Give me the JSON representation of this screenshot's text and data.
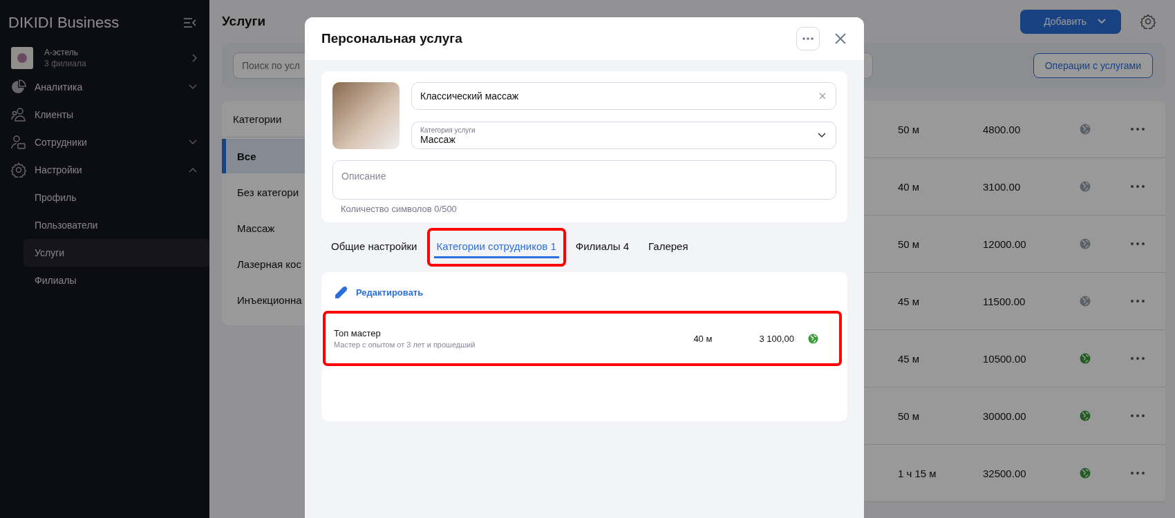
{
  "sidebar": {
    "brand": "DIKIDI Business",
    "account": {
      "name": "А-эстель",
      "subtitle": "3 филиала"
    },
    "nav": [
      {
        "label": "Аналитика",
        "kind": "group",
        "expanded": false
      },
      {
        "label": "Клиенты",
        "kind": "link"
      },
      {
        "label": "Сотрудники",
        "kind": "group",
        "expanded": false
      },
      {
        "label": "Настройки",
        "kind": "group",
        "expanded": true,
        "children": [
          {
            "label": "Профиль",
            "selected": false
          },
          {
            "label": "Пользователи",
            "selected": false
          },
          {
            "label": "Услуги",
            "selected": true
          },
          {
            "label": "Филиалы",
            "selected": false
          }
        ]
      }
    ]
  },
  "page": {
    "title": "Услуги",
    "add_button": "Добавить",
    "search": {
      "placeholder": "Поиск по усл"
    },
    "operations_button": "Операции с услугами",
    "categories": {
      "title": "Категории",
      "items": [
        {
          "label": "Все",
          "selected": true
        },
        {
          "label": "Без категори",
          "selected": false
        },
        {
          "label": "Массаж",
          "selected": false
        },
        {
          "label": "Лазерная кос",
          "selected": false
        },
        {
          "label": "Инъекционна",
          "selected": false
        }
      ]
    },
    "services": [
      {
        "duration": "50 м",
        "price": "4800.00",
        "published": false
      },
      {
        "duration": "40 м",
        "price": "3100.00",
        "published": false
      },
      {
        "duration": "50 м",
        "price": "12000.00",
        "published": false
      },
      {
        "duration": "45 м",
        "price": "11500.00",
        "published": false
      },
      {
        "duration": "45 м",
        "price": "10500.00",
        "published": true
      },
      {
        "duration": "50 м",
        "price": "30000.00",
        "published": true
      },
      {
        "duration": "1 ч 15 м",
        "price": "32500.00",
        "published": true
      }
    ]
  },
  "modal": {
    "title": "Персональная услуга",
    "name_field": {
      "value": "Классический массаж"
    },
    "category_field": {
      "label": "Категория услуги",
      "value": "Массаж"
    },
    "description_field": {
      "placeholder": "Описание"
    },
    "char_count": "Количество символов 0/500",
    "tabs": [
      {
        "label": "Общие настройки",
        "selected": false,
        "highlighted": false
      },
      {
        "label": "Категории сотрудников 1",
        "selected": true,
        "highlighted": true
      },
      {
        "label": "Филиалы 4",
        "selected": false,
        "highlighted": false
      },
      {
        "label": "Галерея",
        "selected": false,
        "highlighted": false
      }
    ],
    "edit_link": "Редактировать",
    "staff_categories": [
      {
        "name": "Топ мастер",
        "description": "Мастер с опытом от 3 лет и прошедший",
        "duration": "40 м",
        "price": "3 100,00",
        "published": true,
        "highlighted": true
      }
    ]
  }
}
